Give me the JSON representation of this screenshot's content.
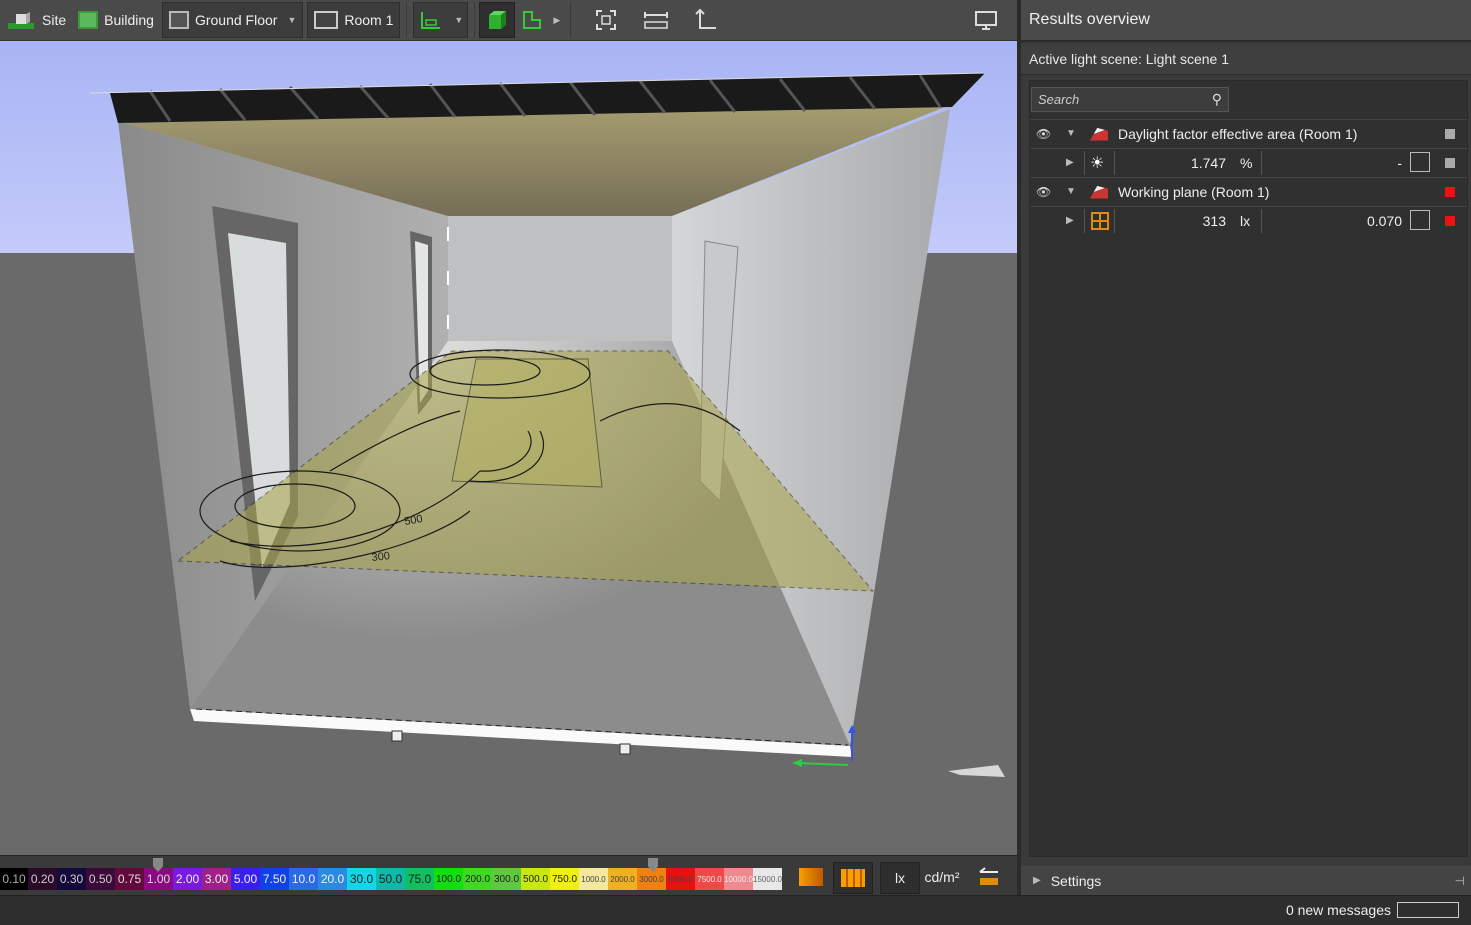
{
  "toolbar": {
    "site_label": "Site",
    "building_label": "Building",
    "floor_label": "Ground Floor",
    "room_label": "Room 1",
    "icons": [
      "site-icon",
      "building-icon",
      "floor-icon",
      "room-icon",
      "working-plane-icon",
      "solid-view-icon",
      "floor-plan-icon",
      "fit-view-icon",
      "measure-icon",
      "height-icon",
      "monitor-icon"
    ]
  },
  "viewport": {
    "contour_labels": [
      "500",
      "300"
    ]
  },
  "legend": {
    "cells": [
      {
        "label": "0.10",
        "bg": "#000000",
        "fg": "#aaaaaa"
      },
      {
        "label": "0.20",
        "bg": "#2a0a2a",
        "fg": "#cccccc"
      },
      {
        "label": "0.30",
        "bg": "#140a3a",
        "fg": "#cccccc"
      },
      {
        "label": "0.50",
        "bg": "#3a0a38",
        "fg": "#cccccc"
      },
      {
        "label": "0.75",
        "bg": "#620a3e",
        "fg": "#dddddd"
      },
      {
        "label": "1.00",
        "bg": "#8a0a82",
        "fg": "#dddddd"
      },
      {
        "label": "2.00",
        "bg": "#7a1ae0",
        "fg": "#eeeeee"
      },
      {
        "label": "3.00",
        "bg": "#a0208a",
        "fg": "#eeeeee"
      },
      {
        "label": "5.00",
        "bg": "#3a1ef0",
        "fg": "#eeeeee"
      },
      {
        "label": "7.50",
        "bg": "#1040e8",
        "fg": "#eeeeee"
      },
      {
        "label": "10.0",
        "bg": "#2a6ae6",
        "fg": "#eeeeee"
      },
      {
        "label": "20.0",
        "bg": "#2a8ae0",
        "fg": "#eeeeee"
      },
      {
        "label": "30.0",
        "bg": "#10d8e8",
        "fg": "#222222"
      },
      {
        "label": "50.0",
        "bg": "#10b8a8",
        "fg": "#222222"
      },
      {
        "label": "75.0",
        "bg": "#10c060",
        "fg": "#222222"
      },
      {
        "label": "100.0",
        "bg": "#10e010",
        "fg": "#222222"
      },
      {
        "label": "200.0",
        "bg": "#40d820",
        "fg": "#222222"
      },
      {
        "label": "300.0",
        "bg": "#60c840",
        "fg": "#222222"
      },
      {
        "label": "500.0",
        "bg": "#c8e810",
        "fg": "#222222"
      },
      {
        "label": "750.0",
        "bg": "#f0f010",
        "fg": "#222222"
      },
      {
        "label": "1000.0",
        "bg": "#f4e8a0",
        "fg": "#444444"
      },
      {
        "label": "2000.0",
        "bg": "#f0b020",
        "fg": "#444444"
      },
      {
        "label": "3000.0",
        "bg": "#f08010",
        "fg": "#444444"
      },
      {
        "label": "5000.0",
        "bg": "#e81010",
        "fg": "#444444"
      },
      {
        "label": "7500.0",
        "bg": "#f04848",
        "fg": "#eeeeee"
      },
      {
        "label": "10000.0",
        "bg": "#f08890",
        "fg": "#eeeeee"
      },
      {
        "label": "15000.0",
        "bg": "#e8e8e8",
        "fg": "#666666"
      }
    ],
    "unit_lx": "lx",
    "unit_cd": "cd/m²"
  },
  "panel": {
    "title": "Results overview",
    "active_scene": "Active light scene: Light scene 1",
    "search_placeholder": "Search",
    "results": [
      {
        "name": "Daylight factor effective area (Room 1)",
        "value": "1.747",
        "unit": "%",
        "extra": "-",
        "status_color": "#aaaaaa"
      },
      {
        "name": "Working plane (Room 1)",
        "value": "313",
        "unit": "lx",
        "extra": "0.070",
        "status_color": "#ee1111"
      }
    ],
    "settings_label": "Settings"
  },
  "status": {
    "messages": "0 new messages"
  }
}
